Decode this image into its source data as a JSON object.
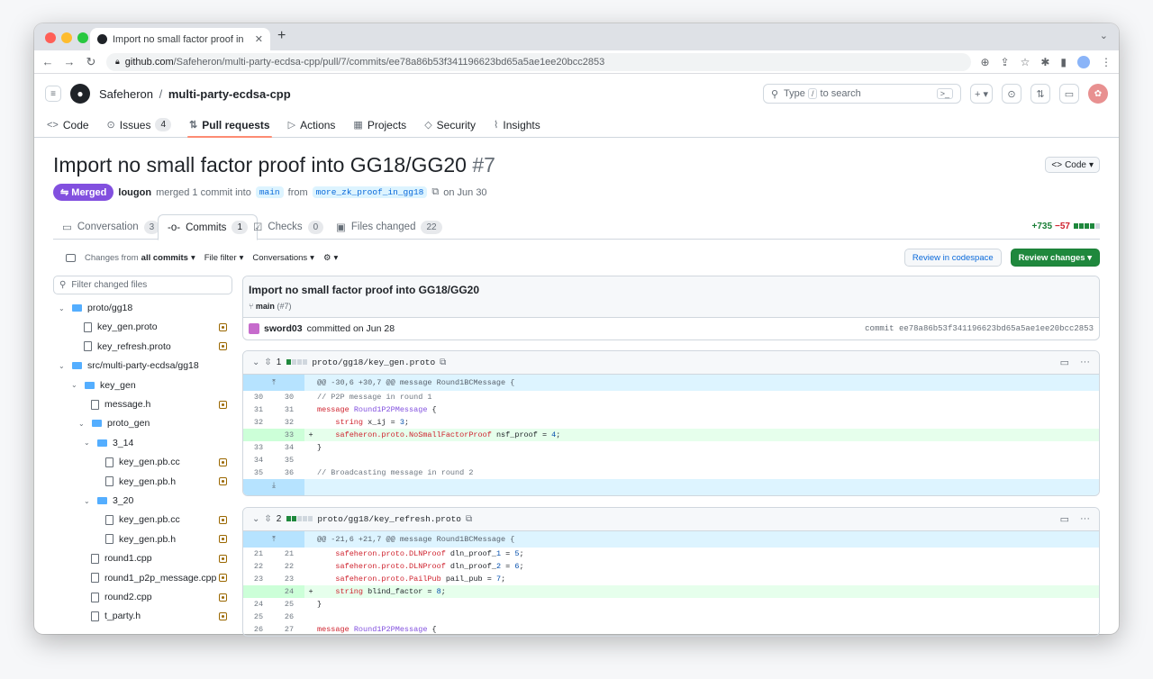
{
  "browser": {
    "tab_title": "Import no small factor proof in",
    "url_host": "github.com",
    "url_path": "/Safeheron/multi-party-ecdsa-cpp/pull/7/commits/ee78a86b53f341196623bd65a5ae1ee20bcc2853"
  },
  "header": {
    "owner": "Safeheron",
    "separator": "/",
    "repo": "multi-party-ecdsa-cpp",
    "search_prefix": "Type",
    "search_key": "/",
    "search_suffix": "to search"
  },
  "repo_nav": [
    {
      "label": "Code",
      "icon": "<>"
    },
    {
      "label": "Issues",
      "icon": "⊙",
      "count": "4"
    },
    {
      "label": "Pull requests",
      "icon": "⇅"
    },
    {
      "label": "Actions",
      "icon": "▷"
    },
    {
      "label": "Projects",
      "icon": "▦"
    },
    {
      "label": "Security",
      "icon": "◇"
    },
    {
      "label": "Insights",
      "icon": "⌇"
    }
  ],
  "pr": {
    "title": "Import no small factor proof into GG18/GG20",
    "number": "#7",
    "status": "Merged",
    "author": "lougon",
    "action": "merged 1 commit into",
    "base": "main",
    "from": "from",
    "head": "more_zk_proof_in_gg18",
    "date": "on Jun 30",
    "code_button": "Code"
  },
  "pr_tabs": [
    {
      "label": "Conversation",
      "count": "3"
    },
    {
      "label": "Commits",
      "count": "1"
    },
    {
      "label": "Checks",
      "count": "0"
    },
    {
      "label": "Files changed",
      "count": "22"
    }
  ],
  "diffstat": {
    "additions": "+735",
    "deletions": "−57"
  },
  "filters": {
    "changes_prefix": "Changes from",
    "changes_value": "all commits",
    "file_filter": "File filter",
    "conversations": "Conversations",
    "codespace": "Review in codespace",
    "review": "Review changes"
  },
  "tree": {
    "filter_placeholder": "Filter changed files",
    "items": [
      {
        "label": "proto/gg18",
        "type": "dir",
        "depth": 0
      },
      {
        "label": "key_gen.proto",
        "type": "file",
        "depth": 1
      },
      {
        "label": "key_refresh.proto",
        "type": "file",
        "depth": 1
      },
      {
        "label": "src/multi-party-ecdsa/gg18",
        "type": "dir",
        "depth": 0
      },
      {
        "label": "key_gen",
        "type": "dir",
        "depth": 1
      },
      {
        "label": "message.h",
        "type": "file",
        "depth": 2
      },
      {
        "label": "proto_gen",
        "type": "dir",
        "depth": 2
      },
      {
        "label": "3_14",
        "type": "dir",
        "depth": 3
      },
      {
        "label": "key_gen.pb.cc",
        "type": "file",
        "depth": 4
      },
      {
        "label": "key_gen.pb.h",
        "type": "file",
        "depth": 4
      },
      {
        "label": "3_20",
        "type": "dir",
        "depth": 3
      },
      {
        "label": "key_gen.pb.cc",
        "type": "file",
        "depth": 4
      },
      {
        "label": "key_gen.pb.h",
        "type": "file",
        "depth": 4
      },
      {
        "label": "round1.cpp",
        "type": "file",
        "depth": 2
      },
      {
        "label": "round1_p2p_message.cpp",
        "type": "file",
        "depth": 2
      },
      {
        "label": "round2.cpp",
        "type": "file",
        "depth": 2
      },
      {
        "label": "t_party.h",
        "type": "file",
        "depth": 2
      }
    ]
  },
  "commit": {
    "title": "Import no small factor proof into GG18/GG20",
    "branch": "main",
    "branch_suffix": "(#7)",
    "author": "sword03",
    "committed": "committed on Jun 28",
    "sha_label": "commit",
    "sha": "ee78a86b53f341196623bd65a5ae1ee20bcc2853"
  },
  "files": [
    {
      "count": "1",
      "path": "proto/gg18/key_gen.proto",
      "hunk": "@@ -30,6 +30,7 @@ message Round1BCMessage {",
      "lines": [
        {
          "old": "30",
          "new": "30",
          "sign": "",
          "code": "// P2P message in round 1",
          "kind": "ctx"
        },
        {
          "old": "31",
          "new": "31",
          "sign": "",
          "code": "message Round1P2PMessage {",
          "kind": "ctx"
        },
        {
          "old": "32",
          "new": "32",
          "sign": "",
          "code": "    string x_ij = 3;",
          "kind": "ctx"
        },
        {
          "old": "",
          "new": "33",
          "sign": "+",
          "code": "    safeheron.proto.NoSmallFactorProof nsf_proof = 4;",
          "kind": "add"
        },
        {
          "old": "33",
          "new": "34",
          "sign": "",
          "code": "}",
          "kind": "ctx"
        },
        {
          "old": "34",
          "new": "35",
          "sign": "",
          "code": "",
          "kind": "ctx"
        },
        {
          "old": "35",
          "new": "36",
          "sign": "",
          "code": "// Broadcasting message in round 2",
          "kind": "ctx"
        }
      ]
    },
    {
      "count": "2",
      "path": "proto/gg18/key_refresh.proto",
      "hunk": "@@ -21,6 +21,7 @@ message Round1BCMessage {",
      "lines": [
        {
          "old": "21",
          "new": "21",
          "sign": "",
          "code": "    safeheron.proto.DLNProof dln_proof_1 = 5;",
          "kind": "ctx"
        },
        {
          "old": "22",
          "new": "22",
          "sign": "",
          "code": "    safeheron.proto.DLNProof dln_proof_2 = 6;",
          "kind": "ctx"
        },
        {
          "old": "23",
          "new": "23",
          "sign": "",
          "code": "    safeheron.proto.PailPub pail_pub = 7;",
          "kind": "ctx"
        },
        {
          "old": "",
          "new": "24",
          "sign": "+",
          "code": "    string blind_factor = 8;",
          "kind": "add"
        },
        {
          "old": "24",
          "new": "25",
          "sign": "",
          "code": "}",
          "kind": "ctx"
        },
        {
          "old": "25",
          "new": "26",
          "sign": "",
          "code": "",
          "kind": "ctx"
        },
        {
          "old": "26",
          "new": "27",
          "sign": "",
          "code": "message Round1P2PMessage {",
          "kind": "ctx"
        }
      ]
    }
  ],
  "colors": {
    "merged": "#8250df",
    "added_bg": "#e6ffec",
    "hunk_bg": "#ddf4ff",
    "review_green": "#1f883d",
    "accent": "#fd8c73"
  }
}
